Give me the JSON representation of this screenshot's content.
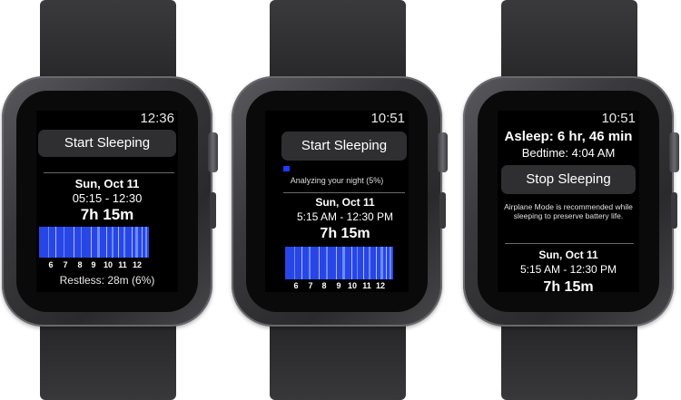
{
  "watch1": {
    "time": "12:36",
    "start_button": "Start Sleeping",
    "date": "Sun, Oct 11",
    "time_range": "05:15 - 12:30",
    "duration": "7h 15m",
    "chart_hours": [
      "6",
      "7",
      "8",
      "9",
      "10",
      "11",
      "12"
    ],
    "restless": "Restless: 28m (6%)"
  },
  "watch2": {
    "time": "10:51",
    "start_button": "Start Sleeping",
    "analyzing": "Analyzing your night (5%)",
    "analyzing_progress_percent": 5,
    "date": "Sun, Oct 11",
    "time_range": "5:15 AM - 12:30 PM",
    "duration": "7h 15m",
    "chart_hours": [
      "6",
      "7",
      "8",
      "9",
      "10",
      "11",
      "12"
    ]
  },
  "watch3": {
    "time": "10:51",
    "asleep": "Asleep: 6 hr, 46 min",
    "bedtime": "Bedtime: 4:04 AM",
    "stop_button": "Stop Sleeping",
    "airplane_note": "Airplane Mode is recommended while sleeping to preserve battery life.",
    "date": "Sun, Oct 11",
    "time_range": "5:15 AM - 12:30 PM",
    "duration": "7h 15m"
  },
  "colors": {
    "chart_blue": "#2846e6",
    "chart_light": "#6a8cff",
    "progress_blue": "#1a3cff"
  }
}
